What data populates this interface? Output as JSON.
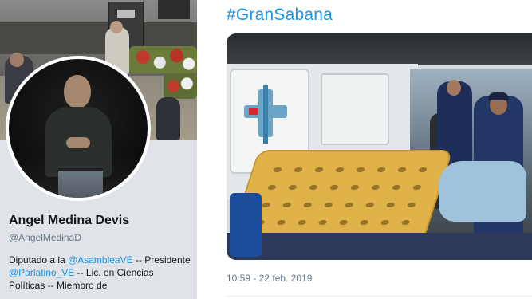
{
  "profile": {
    "name": "Angel Medina Devis",
    "handle": "@AngelMedinaD",
    "bio": {
      "part1": "Diputado a la ",
      "mention1": "@AsambleaVE",
      "part2": " -- Presidente ",
      "mention2": "@Parlatino_VE",
      "part3": " -- Lic. en Ciencias Políticas -- Miembro de"
    }
  },
  "tweet": {
    "hashtag": "#GranSabana",
    "timestamp": "10:59 - 22 feb. 2019"
  },
  "colors": {
    "link": "#1b95e0",
    "muted": "#657786",
    "text": "#14171a"
  }
}
